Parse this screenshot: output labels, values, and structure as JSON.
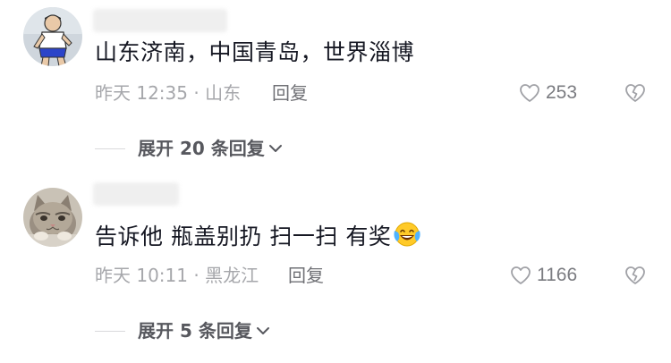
{
  "comments": [
    {
      "avatar_icon": "avatar-soccer-player-cartoon",
      "content": "山东济南，中国青岛，世界淄博",
      "meta": "昨天 12:35 · 山东",
      "reply_label": "回复",
      "like_count": "253",
      "expand_label": "展开 20 条回复"
    },
    {
      "avatar_icon": "avatar-cat-photo",
      "content": "告诉他 瓶盖别扔 扫一扫 有奖",
      "emoji": "laughing-tears-emoji",
      "meta": "昨天 10:11 · 黑龙江",
      "reply_label": "回复",
      "like_count": "1166",
      "expand_label": "展开 5 条回复"
    }
  ],
  "colors": {
    "text_primary": "#161823",
    "text_secondary": "#a6a7ab",
    "reply_text": "#6f7075",
    "expand_text": "#57585e",
    "icon_gray": "#a0a1a6",
    "background": "#ffffff"
  }
}
